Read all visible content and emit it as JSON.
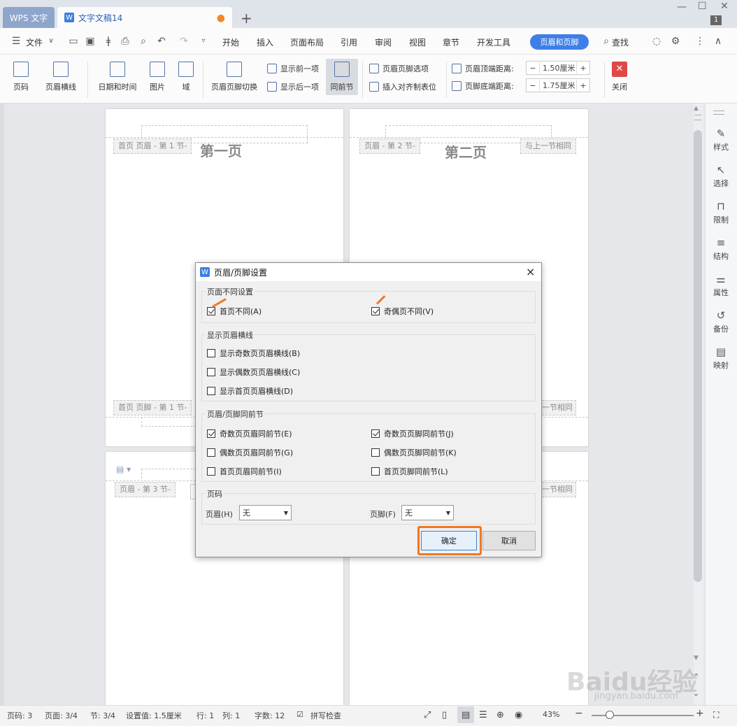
{
  "tabs": {
    "app": "WPS 文字",
    "doc": "文字文稿14",
    "add": "+",
    "dot": "●",
    "win_badge": "1"
  },
  "menu": {
    "file": "文件",
    "items": [
      "开始",
      "插入",
      "页面布局",
      "引用",
      "审阅",
      "视图",
      "章节",
      "开发工具"
    ],
    "active": "页眉和页脚",
    "search": "查找"
  },
  "ribbon": {
    "page_num": "页码",
    "header_line": "页眉横线",
    "datetime": "日期和时间",
    "picture": "图片",
    "field": "域",
    "switch": "页眉页脚切换",
    "show_prev": "显示前一项",
    "show_next": "显示后一项",
    "same_prev": "同前节",
    "options": "页眉页脚选项",
    "insert_tab": "插入对齐制表位",
    "header_top_label": "页眉顶端距离:",
    "header_top_value": "1.50厘米",
    "footer_bottom_label": "页脚底端距离:",
    "footer_bottom_value": "1.75厘米",
    "close": "关闭",
    "minus": "−",
    "plus": "+"
  },
  "doc": {
    "p1_tag": "首页 页眉 - 第 1 节-",
    "p1_title": "第一页",
    "p2_tag": "页眉 - 第 2 节-",
    "p2_title": "第二页",
    "p2_same": "与上一节相同",
    "p1_footer_tag": "首页 页脚 - 第 1 节-",
    "right_same_1": "一节相同",
    "p3_tag": "页眉 - 第 3 节-",
    "right_same_2": "一节相同"
  },
  "sidebar": [
    "样式",
    "选择",
    "限制",
    "结构",
    "属性",
    "备份",
    "映射"
  ],
  "dialog": {
    "title": "页眉/页脚设置",
    "g1": "页面不同设置",
    "first_diff": "首页不同(A)",
    "odd_even_diff": "奇偶页不同(V)",
    "g2": "显示页眉横线",
    "show_odd": "显示奇数页页眉横线(B)",
    "show_even": "显示偶数页页眉横线(C)",
    "show_first": "显示首页页眉横线(D)",
    "g3": "页眉/页脚同前节",
    "odd_hdr": "奇数页页眉同前节(E)",
    "odd_ftr": "奇数页页脚同前节(J)",
    "even_hdr": "偶数页页眉同前节(G)",
    "even_ftr": "偶数页页脚同前节(K)",
    "first_hdr": "首页页眉同前节(I)",
    "first_ftr": "首页页脚同前节(L)",
    "g4": "页码",
    "header_label": "页眉(H)",
    "header_value": "无",
    "footer_label": "页脚(F)",
    "footer_value": "无",
    "ok": "确定",
    "cancel": "取消",
    "close": "×"
  },
  "status": {
    "page": "页码: 3",
    "pages": "页面: 3/4",
    "section": "节: 3/4",
    "setting": "设置值: 1.5厘米",
    "row": "行: 1",
    "col": "列: 1",
    "words": "字数: 12",
    "spell": "拼写检查",
    "zoom": "43%"
  },
  "watermark": {
    "main": "Baidu经验",
    "sub": "jingyan.baidu.com"
  },
  "colors": {
    "accent": "#3d7fe6",
    "highlight": "#f07820"
  }
}
